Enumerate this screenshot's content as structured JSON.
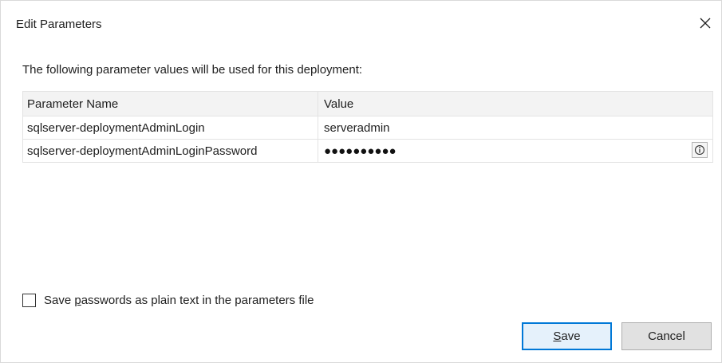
{
  "window": {
    "title": "Edit Parameters",
    "close_icon": "close-icon"
  },
  "instruction": "The following parameter values will be used for this deployment:",
  "table": {
    "columns": [
      "Parameter Name",
      "Value"
    ],
    "rows": [
      {
        "name": "sqlserver-deploymentAdminLogin",
        "value": "serveradmin",
        "masked": false
      },
      {
        "name": "sqlserver-deploymentAdminLoginPassword",
        "value": "●●●●●●●●●●",
        "masked": true,
        "reveal_icon": "reveal-password-icon"
      }
    ]
  },
  "save_plain_text": {
    "checked": false,
    "label_prefix": "Save ",
    "label_accel": "p",
    "label_suffix": "asswords as plain text in the parameters file"
  },
  "buttons": {
    "save_accel": "S",
    "save_rest": "ave",
    "cancel": "Cancel"
  },
  "colors": {
    "accent": "#0078d7",
    "save_bg": "#e5f1fb",
    "cancel_bg": "#e1e1e1"
  }
}
